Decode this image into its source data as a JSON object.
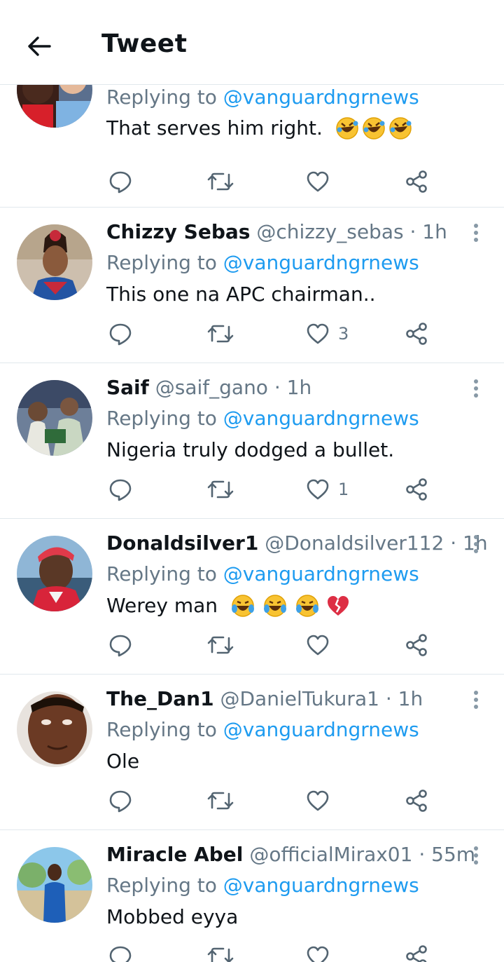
{
  "header": {
    "title": "Tweet",
    "back_icon": "arrow-left-icon"
  },
  "reply_prefix": "Replying to",
  "replies": [
    {
      "name": "",
      "handle": "",
      "time": "",
      "replying_to": "@vanguardngrnews",
      "text": "That serves him right.",
      "emoji": [
        "rofl-emoji",
        "rofl-emoji",
        "rofl-emoji"
      ],
      "likes": ""
    },
    {
      "name": "Chizzy Sebas",
      "handle": "@chizzy_sebas",
      "time": "· 1h",
      "replying_to": "@vanguardngrnews",
      "text": "This one na APC chairman..",
      "likes": "3"
    },
    {
      "name": "Saif",
      "handle": "@saif_gano",
      "time": "· 1h",
      "replying_to": "@vanguardngrnews",
      "text": "Nigeria truly dodged a bullet.",
      "likes": "1"
    },
    {
      "name": "Donaldsilver1",
      "handle": "@Donaldsilver112",
      "time": "· 1h",
      "replying_to": "@vanguardngrnews",
      "text": "Werey man",
      "emoji": [
        "tears-of-joy-emoji",
        "tears-of-joy-emoji",
        "tears-of-joy-emoji",
        "broken-heart-emoji"
      ],
      "likes": ""
    },
    {
      "name": "The_Dan1",
      "handle": "@DanielTukura1",
      "time": "· 1h",
      "replying_to": "@vanguardngrnews",
      "text": "Ole",
      "likes": ""
    },
    {
      "name": "Miracle Abel",
      "handle": "@officialMirax01",
      "time": "· 55m",
      "replying_to": "@vanguardngrnews",
      "text": "Mobbed eyya",
      "likes": ""
    }
  ],
  "icons": {
    "reply": "comment-bubble-icon",
    "retweet": "retweet-icon",
    "like": "heart-icon",
    "share": "share-icon",
    "more": "more-vertical-icon"
  },
  "colors": {
    "link": "#1d9bf0",
    "secondary": "#657786",
    "text": "#0f1419",
    "divider": "#e1e8ed"
  }
}
